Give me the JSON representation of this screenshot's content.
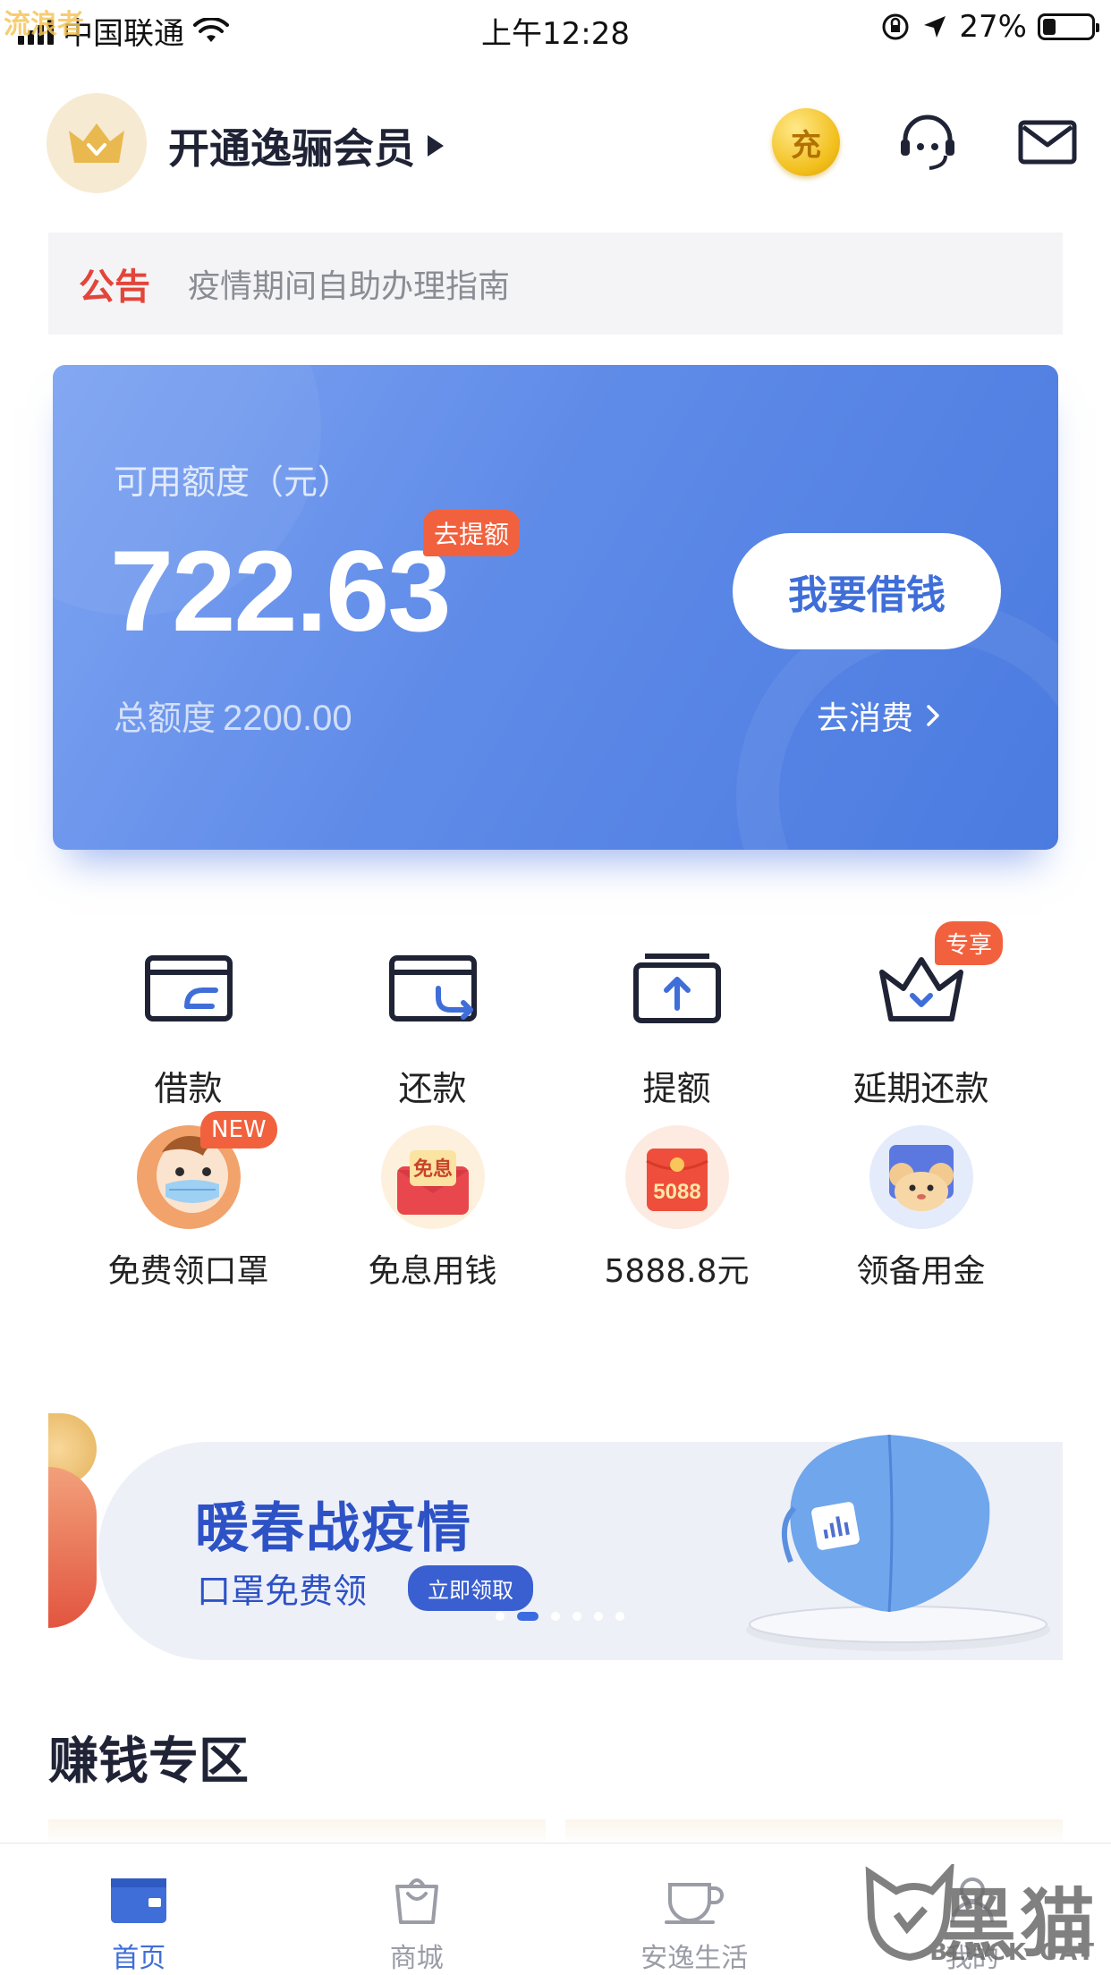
{
  "status_bar": {
    "watermark": "流浪者",
    "carrier": "中国联通",
    "time": "上午12:28",
    "battery": "27%",
    "battery_level": 0.27
  },
  "header": {
    "vip_label": "开通逸骊会员",
    "coin_label": "充"
  },
  "notice": {
    "tag": "公告",
    "text": "疫情期间自助办理指南"
  },
  "credit_card": {
    "available_label": "可用额度（元）",
    "available_amount": "722.63",
    "raise_tag": "去提额",
    "total_label": "总额度",
    "total_amount": "2200.00",
    "borrow_button": "我要借钱",
    "shop_link": "去消费"
  },
  "shortcuts_row1": [
    {
      "label": "借款",
      "icon": "borrow-card-icon"
    },
    {
      "label": "还款",
      "icon": "repay-card-icon"
    },
    {
      "label": "提额",
      "icon": "raise-limit-icon"
    },
    {
      "label": "延期还款",
      "icon": "crown-icon",
      "badge": "专享"
    }
  ],
  "shortcuts_row2": [
    {
      "label": "免费领口罩",
      "icon": "mask-mascot-icon",
      "badge": "NEW"
    },
    {
      "label": "免息用钱",
      "icon": "interest-free-envelope-icon",
      "icon_text": "免息"
    },
    {
      "label": "5888.8元",
      "icon": "red-envelope-icon",
      "icon_text": "5088"
    },
    {
      "label": "领备用金",
      "icon": "mouse-mascot-icon"
    }
  ],
  "banner": {
    "title": "暖春战疫情",
    "subtitle": "口罩免费领",
    "cta": "立即领取",
    "dots": 6,
    "active_dot": 1,
    "accent_color": "#2d52c6"
  },
  "section": {
    "title": "赚钱专区"
  },
  "tabbar": {
    "tabs": [
      {
        "label": "首页",
        "icon": "wallet-icon",
        "active": true
      },
      {
        "label": "商城",
        "icon": "shopping-bag-icon",
        "active": false
      },
      {
        "label": "安逸生活",
        "icon": "cup-icon",
        "active": false
      },
      {
        "label": "我的",
        "icon": "person-icon",
        "active": false
      }
    ],
    "active_color": "#3f6ed8"
  },
  "watermark": {
    "brand_cn": "黑猫",
    "brand_en": "BLACK CAT"
  }
}
